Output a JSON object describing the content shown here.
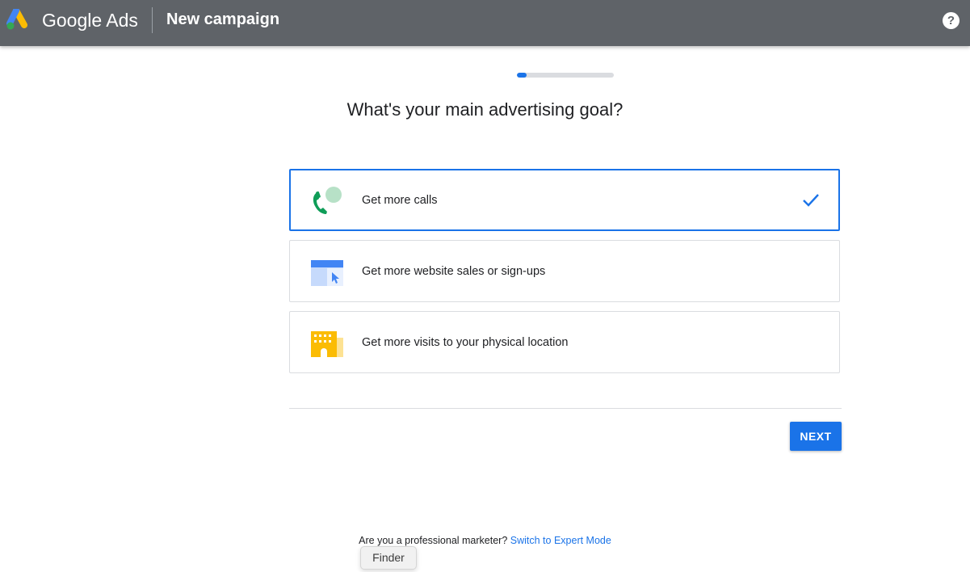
{
  "header": {
    "brand": "Google Ads",
    "title": "New campaign",
    "help_icon": "help-circle-icon",
    "help_glyph": "?",
    "background": "#5f6368"
  },
  "progress": {
    "fraction": 0.1
  },
  "question": "What's your main advertising goal?",
  "goals": [
    {
      "label": "Get more calls",
      "icon": "phone-call-icon",
      "selected": true
    },
    {
      "label": "Get more website sales or sign-ups",
      "icon": "website-click-icon",
      "selected": false
    },
    {
      "label": "Get more visits to your physical location",
      "icon": "storefront-icon",
      "selected": false
    }
  ],
  "next_button": "NEXT",
  "footer": {
    "prompt": "Are you a professional marketer?",
    "link": "Switch to Expert Mode"
  },
  "tooltip": "Finder",
  "colors": {
    "accent": "#1a73e8",
    "call_green": "#0f9d58",
    "location_yellow": "#fbbc04"
  }
}
